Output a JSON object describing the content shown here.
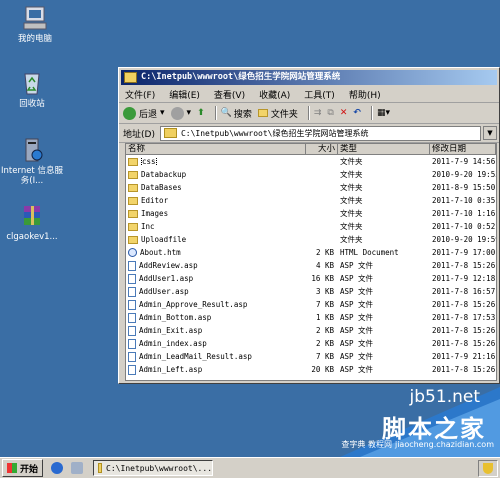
{
  "desktop": {
    "icons": [
      {
        "label": "我的电脑",
        "icon": "my-computer-icon"
      },
      {
        "label": "回收站",
        "icon": "recycle-bin-icon"
      },
      {
        "label": "Internet 信息服务(I...",
        "icon": "iis-icon"
      },
      {
        "label": "clgaokev1...",
        "icon": "winrar-archive-icon"
      }
    ]
  },
  "window": {
    "title": "C:\\Inetpub\\wwwroot\\绿色招生学院网站管理系统",
    "menu": [
      "文件(F)",
      "编辑(E)",
      "查看(V)",
      "收藏(A)",
      "工具(T)",
      "帮助(H)"
    ],
    "toolbar": {
      "back": "后退",
      "search": "搜索",
      "folders": "文件夹"
    },
    "address": {
      "label": "地址(D)",
      "value": "C:\\Inetpub\\wwwroot\\绿色招生学院网站管理系统"
    },
    "columns": {
      "name": "名称",
      "size": "大小",
      "type": "类型",
      "date": "修改日期"
    },
    "files": [
      {
        "name": "css",
        "size": "",
        "type": "文件夹",
        "date": "2011-7-9 14:56",
        "kind": "folder"
      },
      {
        "name": "Databackup",
        "size": "",
        "type": "文件夹",
        "date": "2010-9-20 19:55",
        "kind": "folder"
      },
      {
        "name": "DataBases",
        "size": "",
        "type": "文件夹",
        "date": "2011-8-9 15:50",
        "kind": "folder"
      },
      {
        "name": "Editor",
        "size": "",
        "type": "文件夹",
        "date": "2011-7-10 0:35",
        "kind": "folder"
      },
      {
        "name": "Images",
        "size": "",
        "type": "文件夹",
        "date": "2011-7-10 1:16",
        "kind": "folder"
      },
      {
        "name": "Inc",
        "size": "",
        "type": "文件夹",
        "date": "2011-7-10 0:52",
        "kind": "folder"
      },
      {
        "name": "Uploadfile",
        "size": "",
        "type": "文件夹",
        "date": "2010-9-20 19:59",
        "kind": "folder"
      },
      {
        "name": "About.htm",
        "size": "2 KB",
        "type": "HTML Document",
        "date": "2011-7-9 17:00",
        "kind": "html"
      },
      {
        "name": "AddReview.asp",
        "size": "4 KB",
        "type": "ASP 文件",
        "date": "2011-7-8 15:26",
        "kind": "asp"
      },
      {
        "name": "AddUser1.asp",
        "size": "16 KB",
        "type": "ASP 文件",
        "date": "2011-7-9 12:18",
        "kind": "asp"
      },
      {
        "name": "AddUser.asp",
        "size": "3 KB",
        "type": "ASP 文件",
        "date": "2011-7-8 16:57",
        "kind": "asp"
      },
      {
        "name": "Admin_Approve_Result.asp",
        "size": "7 KB",
        "type": "ASP 文件",
        "date": "2011-7-8 15:26",
        "kind": "asp"
      },
      {
        "name": "Admin_Bottom.asp",
        "size": "1 KB",
        "type": "ASP 文件",
        "date": "2011-7-8 17:53",
        "kind": "asp"
      },
      {
        "name": "Admin_Exit.asp",
        "size": "2 KB",
        "type": "ASP 文件",
        "date": "2011-7-8 15:26",
        "kind": "asp"
      },
      {
        "name": "Admin_index.asp",
        "size": "2 KB",
        "type": "ASP 文件",
        "date": "2011-7-8 15:26",
        "kind": "asp"
      },
      {
        "name": "Admin_LeadMail_Result.asp",
        "size": "7 KB",
        "type": "ASP 文件",
        "date": "2011-7-9 21:16",
        "kind": "asp"
      },
      {
        "name": "Admin_Left.asp",
        "size": "20 KB",
        "type": "ASP 文件",
        "date": "2011-7-8 15:26",
        "kind": "asp"
      }
    ]
  },
  "taskbar": {
    "start": "开始",
    "task": "C:\\Inetpub\\wwwroot\\..."
  },
  "watermark": {
    "site": "jb51.net",
    "brand": "脚本之家",
    "url": "jiaocheng.chazidian.com",
    "overlay": "查字典 教程网"
  }
}
